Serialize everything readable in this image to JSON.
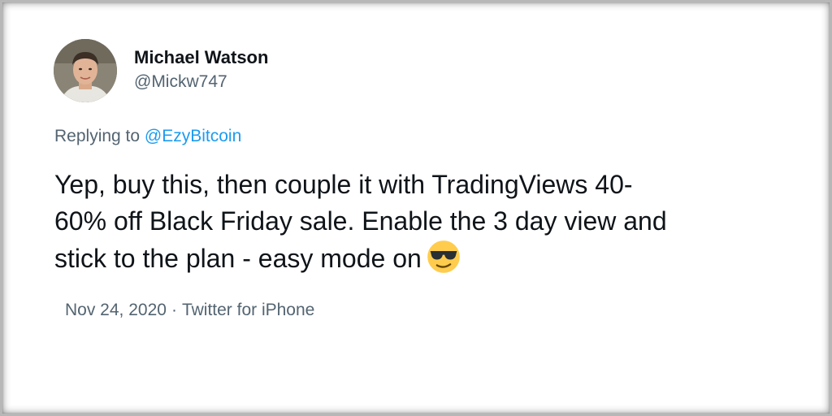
{
  "author": {
    "display_name": "Michael Watson",
    "handle": "@Mickw747"
  },
  "reply": {
    "prefix": "Replying to ",
    "mention": "@EzyBitcoin"
  },
  "tweet": {
    "lines": [
      "Yep, buy this, then couple it with TradingViews 40-",
      "60% off Black Friday sale. Enable the 3 day view and",
      "stick to the plan - easy mode on"
    ],
    "emoji": "smiling-face-with-sunglasses-icon"
  },
  "meta": {
    "date": "Nov 24, 2020",
    "separator": "·",
    "source": "Twitter for iPhone"
  },
  "colors": {
    "text_primary": "#0f1419",
    "text_secondary": "#536471",
    "link": "#1d9bf0",
    "emoji_face": "#ffcc4d"
  }
}
